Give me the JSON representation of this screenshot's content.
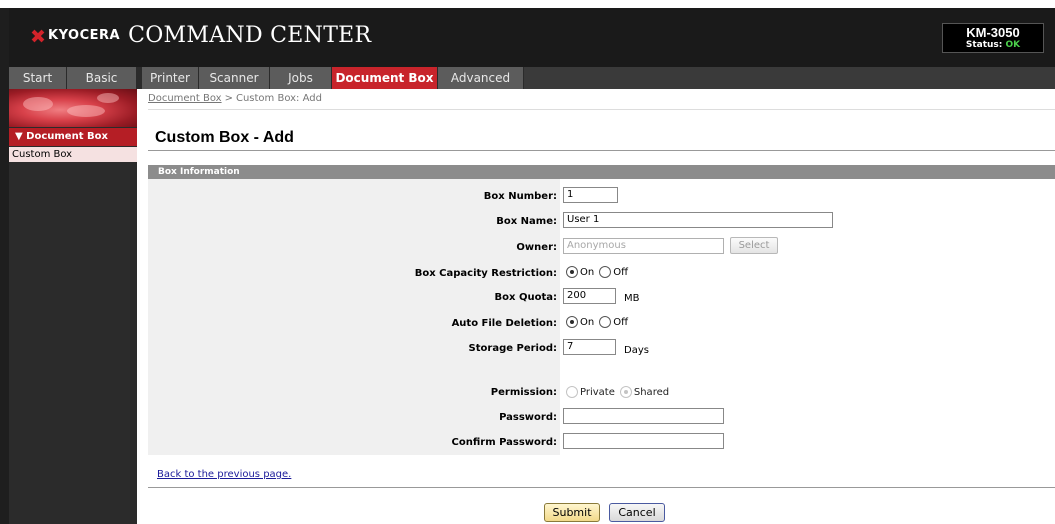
{
  "header": {
    "brand_name": "KYOCERA",
    "app_title": "COMMAND CENTER",
    "model": "KM-3050",
    "status_label": "Status:",
    "status_value": "OK"
  },
  "tabs": [
    {
      "label": "Start"
    },
    {
      "label": "Basic"
    },
    {
      "label": "Printer"
    },
    {
      "label": "Scanner"
    },
    {
      "label": "Jobs"
    },
    {
      "label": "Document Box"
    },
    {
      "label": "Advanced"
    }
  ],
  "sidebar": {
    "section_label": "▼ Document Box",
    "items": [
      {
        "label": "Custom Box"
      }
    ]
  },
  "breadcrumb": {
    "parent": "Document Box",
    "separator": ">",
    "current": "Custom Box: Add"
  },
  "page": {
    "title": "Custom Box - Add",
    "section_title": "Box Information"
  },
  "form": {
    "box_number": {
      "label": "Box Number:",
      "value": "1"
    },
    "box_name": {
      "label": "Box Name:",
      "value": "User 1"
    },
    "owner": {
      "label": "Owner:",
      "value": "Anonymous",
      "select_label": "Select"
    },
    "capacity_restriction": {
      "label": "Box Capacity Restriction:",
      "on": "On",
      "off": "Off",
      "selected": "On"
    },
    "box_quota": {
      "label": "Box Quota:",
      "value": "200",
      "unit": "MB"
    },
    "auto_deletion": {
      "label": "Auto File Deletion:",
      "on": "On",
      "off": "Off",
      "selected": "On"
    },
    "storage_period": {
      "label": "Storage Period:",
      "value": "7",
      "unit": "Days"
    },
    "permission": {
      "label": "Permission:",
      "private": "Private",
      "shared": "Shared",
      "selected": "Shared"
    },
    "password": {
      "label": "Password:",
      "value": ""
    },
    "confirm_password": {
      "label": "Confirm Password:",
      "value": ""
    }
  },
  "footer": {
    "back_link": "Back to the previous page.",
    "submit_label": "Submit",
    "cancel_label": "Cancel"
  },
  "colors": {
    "accent_red": "#c8242b",
    "status_ok": "#4cd04c"
  }
}
